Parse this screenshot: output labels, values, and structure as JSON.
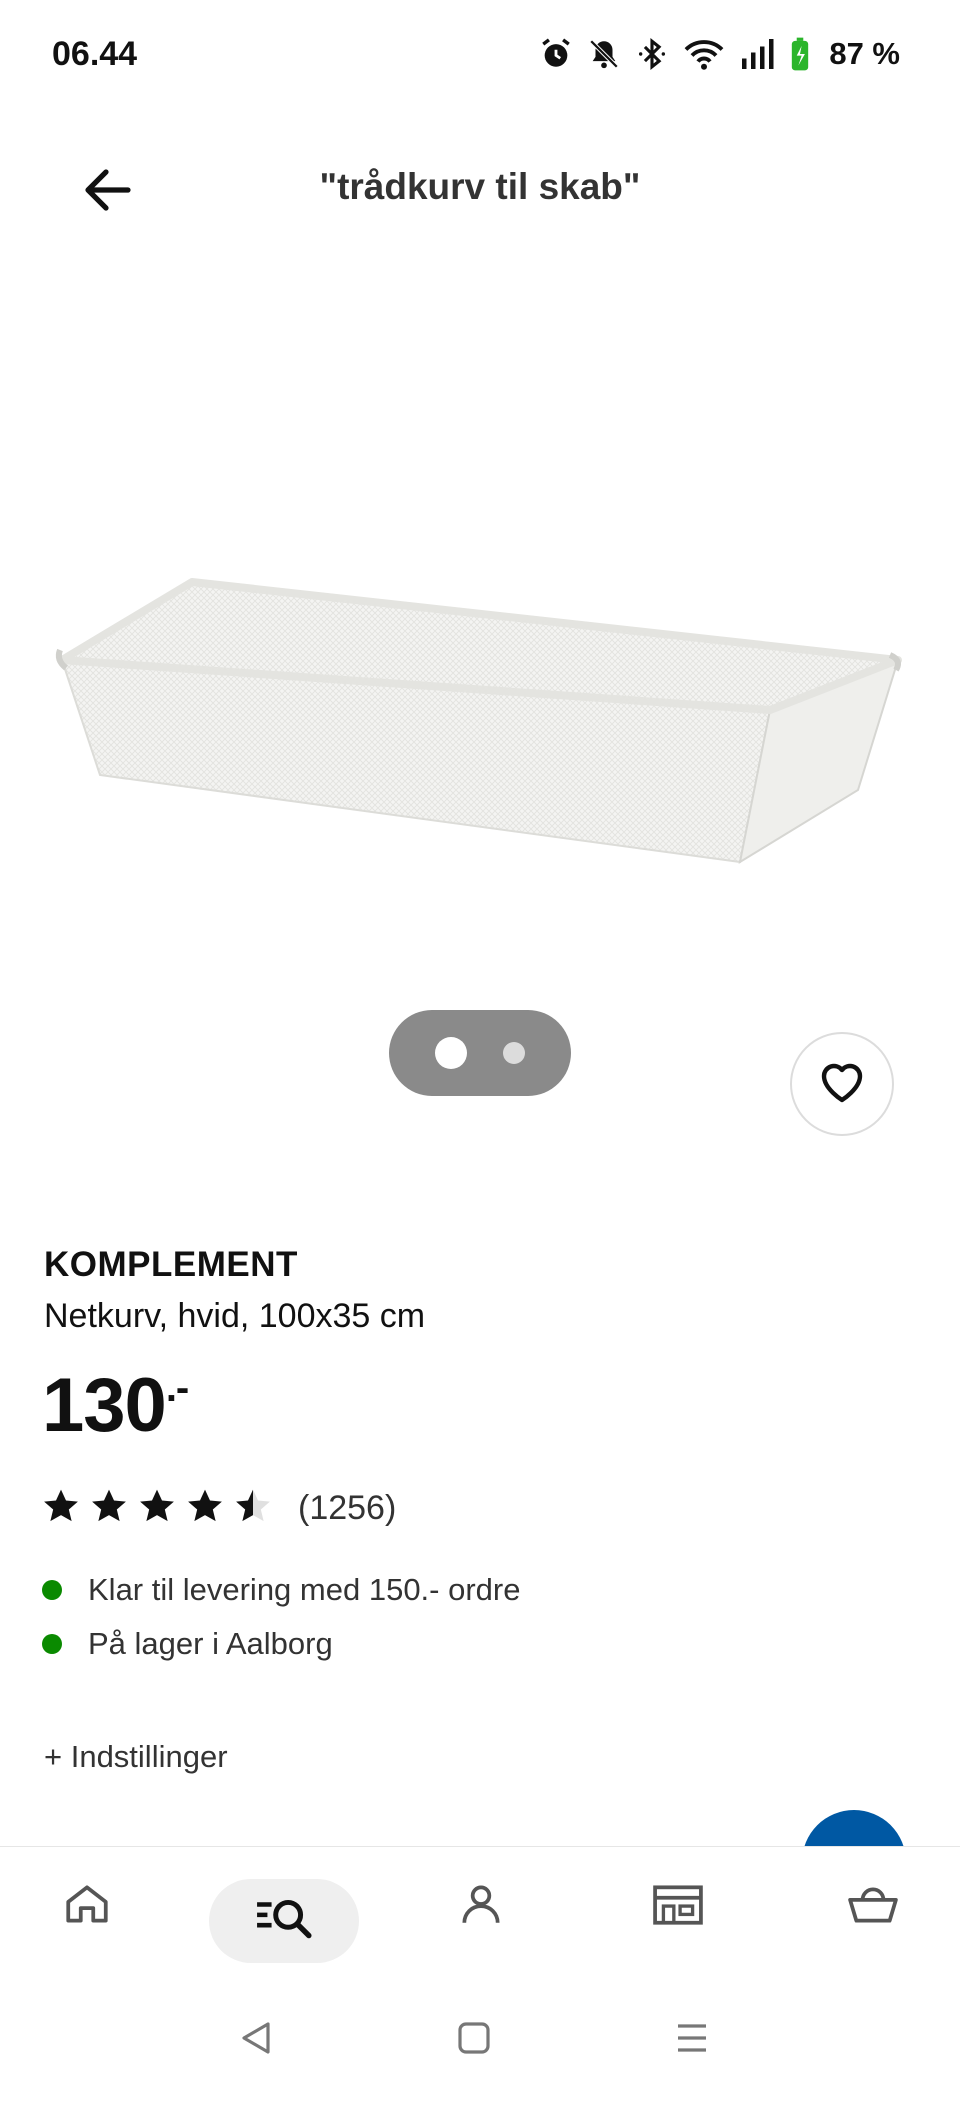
{
  "status_bar": {
    "time": "06.44",
    "battery": "87 %",
    "icons": [
      "alarm-icon",
      "bell-off-icon",
      "bluetooth-icon",
      "wifi-icon",
      "signal-icon",
      "battery-charging-icon"
    ]
  },
  "header": {
    "back_icon": "arrow-left-icon",
    "title": "\"trådkurv til skab\""
  },
  "gallery": {
    "image": "white wire mesh basket",
    "page_count": 2,
    "current_page": 1
  },
  "product": {
    "brand": "KOMPLEMENT",
    "description": "Netkurv, hvid, 100x35 cm",
    "price_main": "130",
    "price_suffix": ".-",
    "rating_value": 4.5,
    "rating_max": 5,
    "review_count": "(1256)",
    "availability": [
      {
        "text": "Klar til levering med 150.- ordre",
        "status_color": "#0a8a00"
      },
      {
        "text": "På lager i Aalborg",
        "status_color": "#0a8a00"
      }
    ],
    "options_label": "+ Indstillinger"
  },
  "bottom_nav": {
    "items": [
      {
        "name": "home-icon",
        "active": false
      },
      {
        "name": "search-list-icon",
        "active": true
      },
      {
        "name": "profile-icon",
        "active": false
      },
      {
        "name": "store-icon",
        "active": false
      },
      {
        "name": "basket-icon",
        "active": false
      }
    ]
  },
  "colors": {
    "accent_blue": "#0058a3",
    "in_stock_green": "#0a8a00",
    "pager_bg": "#8a8a8a"
  }
}
